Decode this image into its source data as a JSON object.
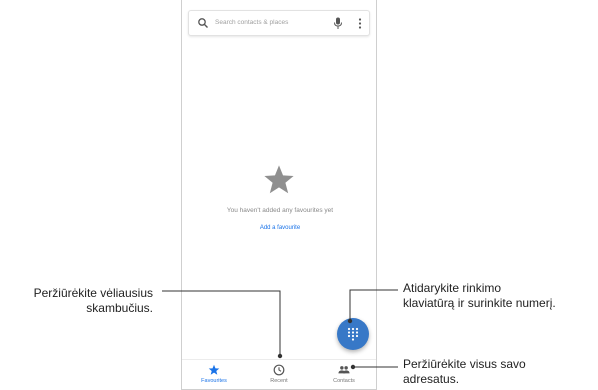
{
  "search": {
    "placeholder": "Search contacts & places"
  },
  "empty_state": {
    "message": "You haven't added any favourites yet",
    "action_label": "Add a favourite"
  },
  "nav": {
    "items": [
      {
        "label": "Favourites",
        "icon": "star-icon",
        "active": true
      },
      {
        "label": "Recent",
        "icon": "clock-icon",
        "active": false
      },
      {
        "label": "Contacts",
        "icon": "people-icon",
        "active": false
      }
    ]
  },
  "fab": {
    "icon": "dialpad-icon"
  },
  "callouts": {
    "recent": [
      "Peržiūrėkite vėliausius",
      "skambučius."
    ],
    "dialpad": [
      "Atidarykite rinkimo",
      "klaviatūrą ir surinkite numerį."
    ],
    "contacts": [
      "Peržiūrėkite visus savo",
      "adresatus."
    ]
  },
  "colors": {
    "accent": "#1a73e8",
    "fab": "#3778c7",
    "star_gray": "#8f8f8f",
    "leader": "#333333"
  }
}
